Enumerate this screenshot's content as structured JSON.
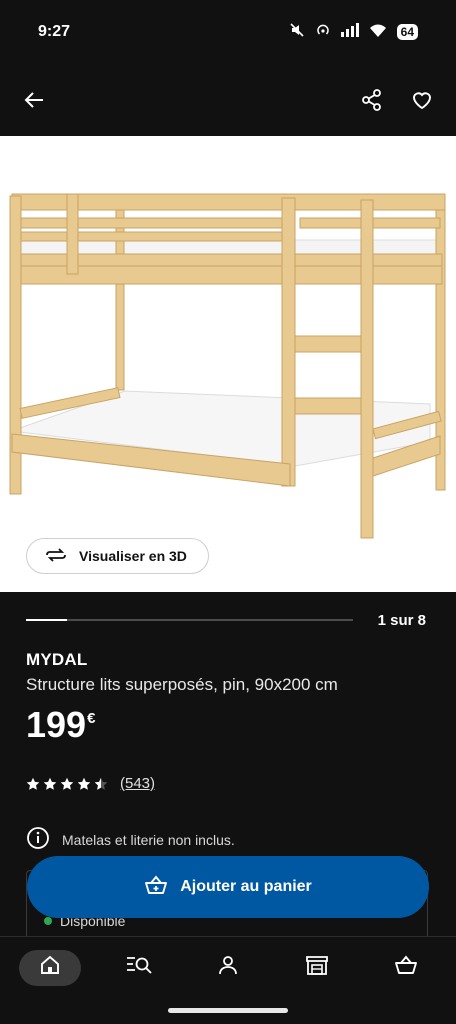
{
  "status": {
    "time": "9:27",
    "battery": "64"
  },
  "product": {
    "view3d_label": "Visualiser en 3D",
    "gallery_counter": "1 sur 8",
    "gallery_progress": 0.125,
    "brand": "MYDAL",
    "description": "Structure lits superposés, pin, 90x200 cm",
    "price": "199",
    "currency": "€",
    "rating": 4.5,
    "review_count": "(543)",
    "notice": "Matelas et literie non inclus.",
    "availability": "Disponible"
  },
  "cart": {
    "label": "Ajouter au panier"
  },
  "nav": {
    "items": [
      "home-icon",
      "search-icon",
      "profile-icon",
      "store-icon",
      "basket-icon"
    ],
    "active": "home-icon"
  },
  "colors": {
    "background": "#111111",
    "accent": "#0058a3",
    "available": "#2fa84f",
    "wood": "#e8c98f"
  }
}
